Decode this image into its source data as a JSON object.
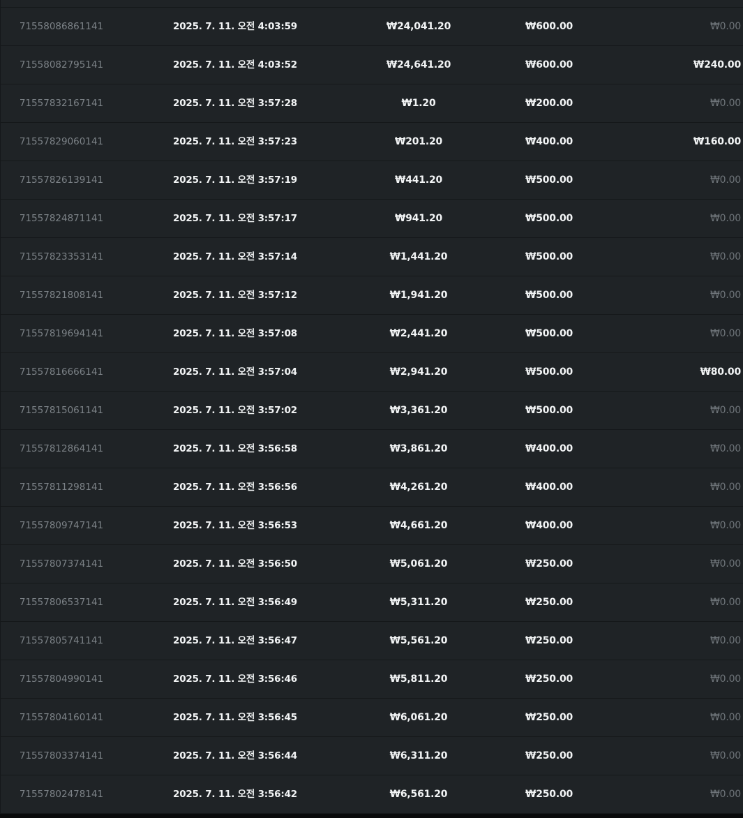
{
  "rows": [
    {
      "id": "71558086861141",
      "time": "2025. 7. 11. 오전 4:03:59",
      "balance": "₩24,041.20",
      "bet": "₩600.00",
      "win": "₩0.00"
    },
    {
      "id": "71558082795141",
      "time": "2025. 7. 11. 오전 4:03:52",
      "balance": "₩24,641.20",
      "bet": "₩600.00",
      "win": "₩240.00"
    },
    {
      "id": "71557832167141",
      "time": "2025. 7. 11. 오전 3:57:28",
      "balance": "₩1.20",
      "bet": "₩200.00",
      "win": "₩0.00"
    },
    {
      "id": "71557829060141",
      "time": "2025. 7. 11. 오전 3:57:23",
      "balance": "₩201.20",
      "bet": "₩400.00",
      "win": "₩160.00"
    },
    {
      "id": "71557826139141",
      "time": "2025. 7. 11. 오전 3:57:19",
      "balance": "₩441.20",
      "bet": "₩500.00",
      "win": "₩0.00"
    },
    {
      "id": "71557824871141",
      "time": "2025. 7. 11. 오전 3:57:17",
      "balance": "₩941.20",
      "bet": "₩500.00",
      "win": "₩0.00"
    },
    {
      "id": "71557823353141",
      "time": "2025. 7. 11. 오전 3:57:14",
      "balance": "₩1,441.20",
      "bet": "₩500.00",
      "win": "₩0.00"
    },
    {
      "id": "71557821808141",
      "time": "2025. 7. 11. 오전 3:57:12",
      "balance": "₩1,941.20",
      "bet": "₩500.00",
      "win": "₩0.00"
    },
    {
      "id": "71557819694141",
      "time": "2025. 7. 11. 오전 3:57:08",
      "balance": "₩2,441.20",
      "bet": "₩500.00",
      "win": "₩0.00"
    },
    {
      "id": "71557816666141",
      "time": "2025. 7. 11. 오전 3:57:04",
      "balance": "₩2,941.20",
      "bet": "₩500.00",
      "win": "₩80.00"
    },
    {
      "id": "71557815061141",
      "time": "2025. 7. 11. 오전 3:57:02",
      "balance": "₩3,361.20",
      "bet": "₩500.00",
      "win": "₩0.00"
    },
    {
      "id": "71557812864141",
      "time": "2025. 7. 11. 오전 3:56:58",
      "balance": "₩3,861.20",
      "bet": "₩400.00",
      "win": "₩0.00"
    },
    {
      "id": "71557811298141",
      "time": "2025. 7. 11. 오전 3:56:56",
      "balance": "₩4,261.20",
      "bet": "₩400.00",
      "win": "₩0.00"
    },
    {
      "id": "71557809747141",
      "time": "2025. 7. 11. 오전 3:56:53",
      "balance": "₩4,661.20",
      "bet": "₩400.00",
      "win": "₩0.00"
    },
    {
      "id": "71557807374141",
      "time": "2025. 7. 11. 오전 3:56:50",
      "balance": "₩5,061.20",
      "bet": "₩250.00",
      "win": "₩0.00"
    },
    {
      "id": "71557806537141",
      "time": "2025. 7. 11. 오전 3:56:49",
      "balance": "₩5,311.20",
      "bet": "₩250.00",
      "win": "₩0.00"
    },
    {
      "id": "71557805741141",
      "time": "2025. 7. 11. 오전 3:56:47",
      "balance": "₩5,561.20",
      "bet": "₩250.00",
      "win": "₩0.00"
    },
    {
      "id": "71557804990141",
      "time": "2025. 7. 11. 오전 3:56:46",
      "balance": "₩5,811.20",
      "bet": "₩250.00",
      "win": "₩0.00"
    },
    {
      "id": "71557804160141",
      "time": "2025. 7. 11. 오전 3:56:45",
      "balance": "₩6,061.20",
      "bet": "₩250.00",
      "win": "₩0.00"
    },
    {
      "id": "71557803374141",
      "time": "2025. 7. 11. 오전 3:56:44",
      "balance": "₩6,311.20",
      "bet": "₩250.00",
      "win": "₩0.00"
    },
    {
      "id": "71557802478141",
      "time": "2025. 7. 11. 오전 3:56:42",
      "balance": "₩6,561.20",
      "bet": "₩250.00",
      "win": "₩0.00"
    }
  ]
}
